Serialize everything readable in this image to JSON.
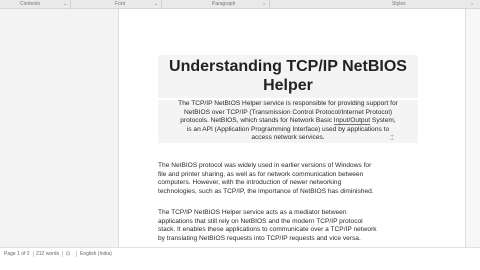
{
  "ribbon": {
    "items": [
      {
        "label": "Contents"
      },
      {
        "label": "Font"
      },
      {
        "label": "Paragraph"
      },
      {
        "label": "Styles"
      }
    ]
  },
  "document": {
    "title_line1": "Understanding TCP/IP NetBIOS",
    "title_line2": "Helper",
    "p1": [
      "The TCP/IP NetBIOS Helper service is responsible for providing support for",
      "NetBIOS over TCP/IP (Transmission Control Protocol/Internet Protocol)",
      "protocols. NetBIOS, which stands for Network Basic ",
      "Input/Output",
      " System,",
      "is an API (Application Programming Interface) used by applications to",
      "access network services."
    ],
    "p2": [
      "The NetBIOS protocol was widely used in earlier versions of Windows for",
      "file and printer sharing, as well as for network communication between",
      "computers. However, with the introduction of newer networking",
      "technologies, such as TCP/IP, the importance of NetBIOS has diminished."
    ],
    "p3": [
      "The TCP/IP NetBIOS Helper service acts as a mediator between",
      "applications that still rely on NetBIOS and the modern TCP/IP protocol",
      "stack. It enables these applications to communicate over a TCP/IP network",
      "by translating NetBIOS requests into TCP/IP requests and vice versa."
    ]
  },
  "status": {
    "page": "Page 1 of 2",
    "words": "212 words",
    "lang_icon": "proofing-icon",
    "language": "English (India)"
  }
}
